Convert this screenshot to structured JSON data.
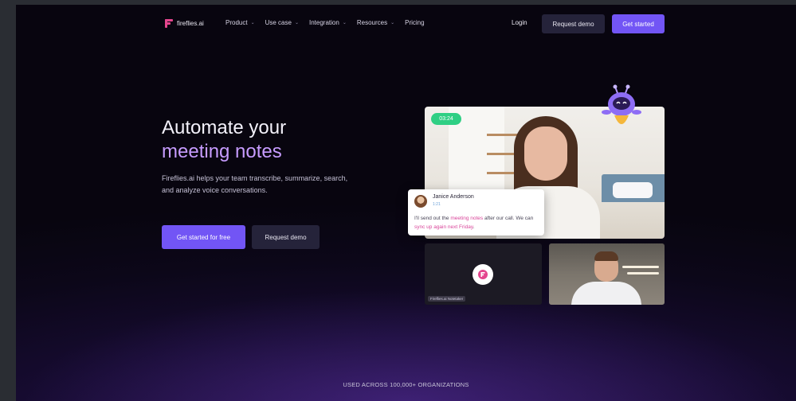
{
  "nav": {
    "logo_text": "fireflies.ai",
    "menu": [
      {
        "label": "Product",
        "has_dropdown": true
      },
      {
        "label": "Use case",
        "has_dropdown": true
      },
      {
        "label": "Integration",
        "has_dropdown": true
      },
      {
        "label": "Resources",
        "has_dropdown": true
      },
      {
        "label": "Pricing",
        "has_dropdown": false
      }
    ],
    "login": "Login",
    "request_demo": "Request demo",
    "get_started": "Get started"
  },
  "hero": {
    "title_line1": "Automate your",
    "title_line2": "meeting notes",
    "description": "Fireflies.ai helps your team transcribe, summarize, search, and analyze voice conversations.",
    "cta_primary": "Get started for free",
    "cta_secondary": "Request demo"
  },
  "video": {
    "timer": "03:24",
    "chat": {
      "name": "Janice Anderson",
      "time": "1:21",
      "msg_part1": "I'll send out the ",
      "msg_hl1": "meeting notes",
      "msg_part2": " after our call. We can ",
      "msg_hl2": "sync up again next Friday",
      "msg_part3": "."
    },
    "notetaker_label": "Fireflies.ai Notetaker"
  },
  "footer": {
    "text": "USED ACROSS 100,000+ ORGANIZATIONS"
  },
  "colors": {
    "accent": "#7255f5",
    "brand_pink": "#e4468e",
    "highlight_purple": "#c79cff",
    "timer_green": "#2fcf84",
    "background": "#0c0719"
  },
  "icons": [
    "fireflies-logo-icon",
    "chevron-down-icon",
    "robot-mascot-icon"
  ]
}
